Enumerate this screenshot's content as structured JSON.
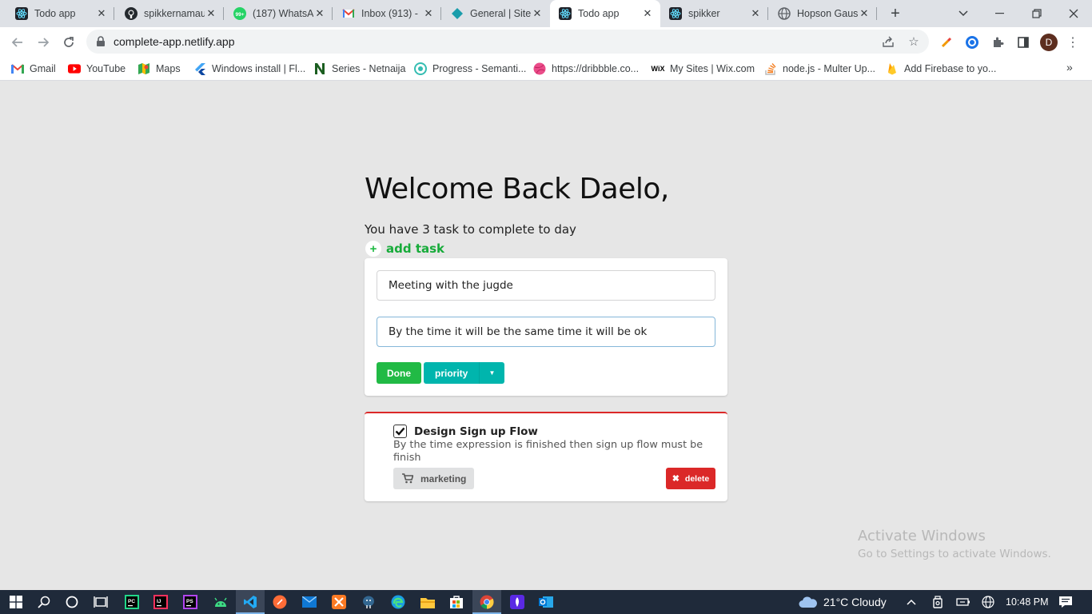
{
  "browser": {
    "tabs": [
      {
        "title": "Todo app",
        "icon": "react-icon"
      },
      {
        "title": "spikkernamau",
        "icon": "github-icon"
      },
      {
        "title": "(187) WhatsA",
        "icon": "whatsapp-icon"
      },
      {
        "title": "Inbox (913) -",
        "icon": "gmail-icon"
      },
      {
        "title": "General | Site",
        "icon": "diamond-icon"
      },
      {
        "title": "Todo app",
        "icon": "react-icon"
      },
      {
        "title": "spikker",
        "icon": "react-icon"
      },
      {
        "title": "Hopson Gaus",
        "icon": "globe-icon"
      }
    ],
    "active_tab": 5,
    "url": "complete-app.netlify.app",
    "profile_initial": "D",
    "bookmarks": [
      {
        "label": "Gmail"
      },
      {
        "label": "YouTube"
      },
      {
        "label": "Maps"
      },
      {
        "label": "Windows install | Fl..."
      },
      {
        "label": "Series - Netnaija"
      },
      {
        "label": "Progress - Semanti..."
      },
      {
        "label": "https://dribbble.co..."
      },
      {
        "label": "My Sites | Wix.com"
      },
      {
        "label": "node.js - Multer Up..."
      },
      {
        "label": "Add Firebase to yo..."
      }
    ]
  },
  "page": {
    "welcome": "Welcome Back Daelo,",
    "subtitle": "You have 3 task to complete to day",
    "add_task_label": "add task",
    "form": {
      "title_value": "Meeting with the jugde",
      "description_value": "By the  time it will be the same time it will be ok",
      "done_label": "Done",
      "priority_label": "priority"
    },
    "task": {
      "title": "Design Sign up Flow",
      "description": "By the time expression is finished then sign up flow must be finish",
      "tag": "marketing",
      "delete_label": "delete",
      "checked": true
    }
  },
  "watermark": {
    "line1": "Activate Windows",
    "line2": "Go to Settings to activate Windows."
  },
  "taskbar": {
    "weather": "21°C  Cloudy",
    "time": "10:48 PM"
  },
  "colors": {
    "green": "#21ba45",
    "teal": "#00b5ad",
    "red": "#db2828",
    "page_bg": "#e6e6e6"
  }
}
